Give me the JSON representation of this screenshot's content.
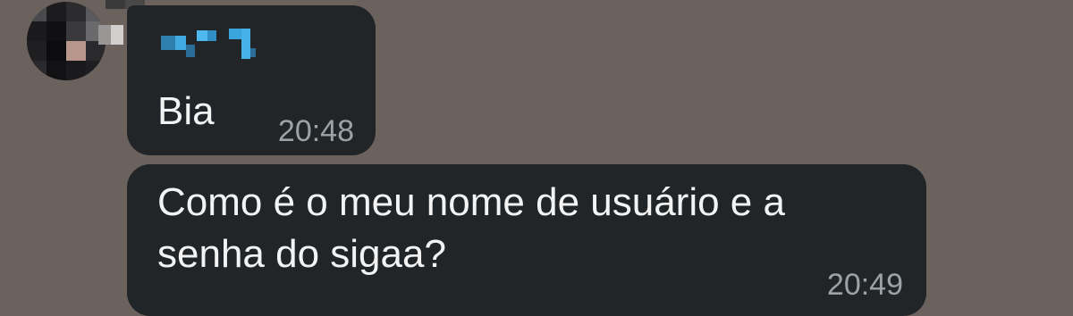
{
  "chat": {
    "messages": [
      {
        "text": "Bia",
        "time": "20:48"
      },
      {
        "text": "Como é o meu nome de usuário e a senha do sigaa?",
        "time": "20:49"
      }
    ]
  },
  "colors": {
    "background": "#6b615d",
    "bubble": "#212528",
    "text": "#f3f3f3",
    "timestamp": "#9ca3a7",
    "sender_name": "#3fa9e0"
  }
}
